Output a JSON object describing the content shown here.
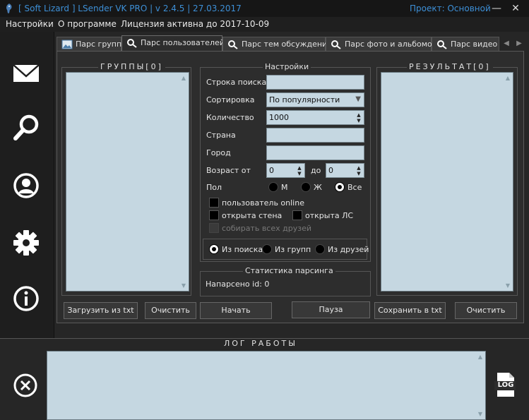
{
  "window": {
    "title": "[ Soft Lizard ] LSender VK PRO | v 2.4.5 | 27.03.2017",
    "project": "Проект: Основной",
    "minimize": "—",
    "close": "✕"
  },
  "menu": {
    "items": [
      "Настройки",
      "О программе",
      "Лицензия активна до 2017-10-09"
    ]
  },
  "sidebar": {
    "icons": [
      "envelope-icon",
      "search-icon",
      "user-icon",
      "gear-icon",
      "info-icon"
    ]
  },
  "tabs": [
    {
      "label": "Парс групп",
      "icon": "image-icon"
    },
    {
      "label": "Парс пользователей",
      "icon": "search-icon",
      "active": true
    },
    {
      "label": "Парс тем обсуждений",
      "icon": "search-icon"
    },
    {
      "label": "Парс фото и альбомов",
      "icon": "search-icon"
    },
    {
      "label": "Парс видео",
      "icon": "search-icon"
    }
  ],
  "tab_scroll": {
    "left": "◀",
    "right": "▶"
  },
  "groups": {
    "title": "ГРУППЫ[0]",
    "load_button": "Загрузить из txt",
    "clear_button": "Очистить"
  },
  "results": {
    "title": "РЕЗУЛЬТАТ[0]",
    "save_button": "Сохранить в txt",
    "clear_button": "Очистить"
  },
  "settings": {
    "title": "Настройки",
    "search_label": "Строка поиска",
    "search_value": "",
    "sort_label": "Сортировка",
    "sort_value": "По популярности",
    "count_label": "Количество",
    "count_value": "1000",
    "country_label": "Страна",
    "country_value": "",
    "city_label": "Город",
    "city_value": "",
    "age_from_label": "Возраст от",
    "age_from_value": "0",
    "age_to_label": "до",
    "age_to_value": "0",
    "sex_label": "Пол",
    "sex_options": [
      "М",
      "Ж",
      "Все"
    ],
    "sex_selected": "Все",
    "online_label": "пользователь online",
    "wall_label": "открыта стена",
    "pm_label": "открыта ЛС",
    "friends_label": "собирать всех друзей",
    "source_options": [
      "Из поиска",
      "Из групп",
      "Из друзей"
    ],
    "source_selected": "Из поиска"
  },
  "stats": {
    "title": "Статистика парсинга",
    "parsed": "Напарсено id: 0"
  },
  "actions": {
    "start": "Начать",
    "pause": "Пауза"
  },
  "log": {
    "title": "ЛОГ РАБОТЫ",
    "log_icon_text": "LOG"
  },
  "colors": {
    "accent": "#3d8fd6",
    "field_bg": "#c5d7e1",
    "background": "#2d2d2d"
  }
}
